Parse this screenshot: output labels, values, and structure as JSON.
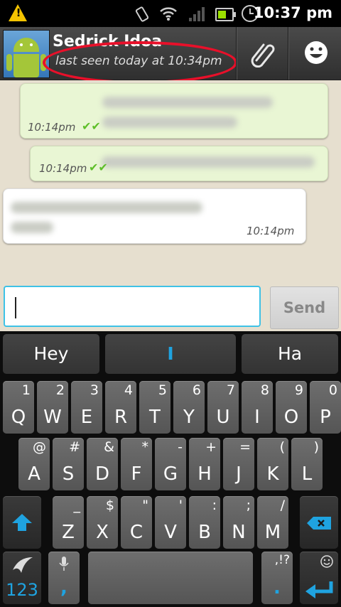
{
  "status_bar": {
    "time": "10:37 pm",
    "warning_mark": "!"
  },
  "header": {
    "contact_name": "Sedrick Idoa",
    "last_seen": "last seen today at 10:34pm",
    "highlight_color": "#e8102a"
  },
  "messages": [
    {
      "direction": "outgoing",
      "time": "10:14pm",
      "status": "delivered"
    },
    {
      "direction": "outgoing",
      "time": "10:14pm",
      "status": "delivered"
    },
    {
      "direction": "incoming",
      "time": "10:14pm"
    }
  ],
  "composer": {
    "value": "",
    "send_label": "Send"
  },
  "keyboard": {
    "suggestions": [
      "Hey",
      "I",
      "Ha"
    ],
    "row1": [
      {
        "k": "Q",
        "a": "1"
      },
      {
        "k": "W",
        "a": "2"
      },
      {
        "k": "E",
        "a": "3"
      },
      {
        "k": "R",
        "a": "4"
      },
      {
        "k": "T",
        "a": "5"
      },
      {
        "k": "Y",
        "a": "6"
      },
      {
        "k": "U",
        "a": "7"
      },
      {
        "k": "I",
        "a": "8"
      },
      {
        "k": "O",
        "a": "9"
      },
      {
        "k": "P",
        "a": "0"
      }
    ],
    "row2": [
      {
        "k": "A",
        "a": "@"
      },
      {
        "k": "S",
        "a": "#"
      },
      {
        "k": "D",
        "a": "&"
      },
      {
        "k": "F",
        "a": "*"
      },
      {
        "k": "G",
        "a": "-"
      },
      {
        "k": "H",
        "a": "+"
      },
      {
        "k": "J",
        "a": "="
      },
      {
        "k": "K",
        "a": "("
      },
      {
        "k": "L",
        "a": ")"
      }
    ],
    "row3": [
      {
        "k": "Z",
        "a": "_"
      },
      {
        "k": "X",
        "a": "$"
      },
      {
        "k": "C",
        "a": "\""
      },
      {
        "k": "V",
        "a": "'"
      },
      {
        "k": "B",
        "a": ":"
      },
      {
        "k": "N",
        "a": ";"
      },
      {
        "k": "M",
        "a": "/"
      }
    ],
    "numbers_label": "123",
    "comma": ",",
    "period": ".",
    "punct_alt": ",!?",
    "accent_color": "#1fa3e0"
  }
}
